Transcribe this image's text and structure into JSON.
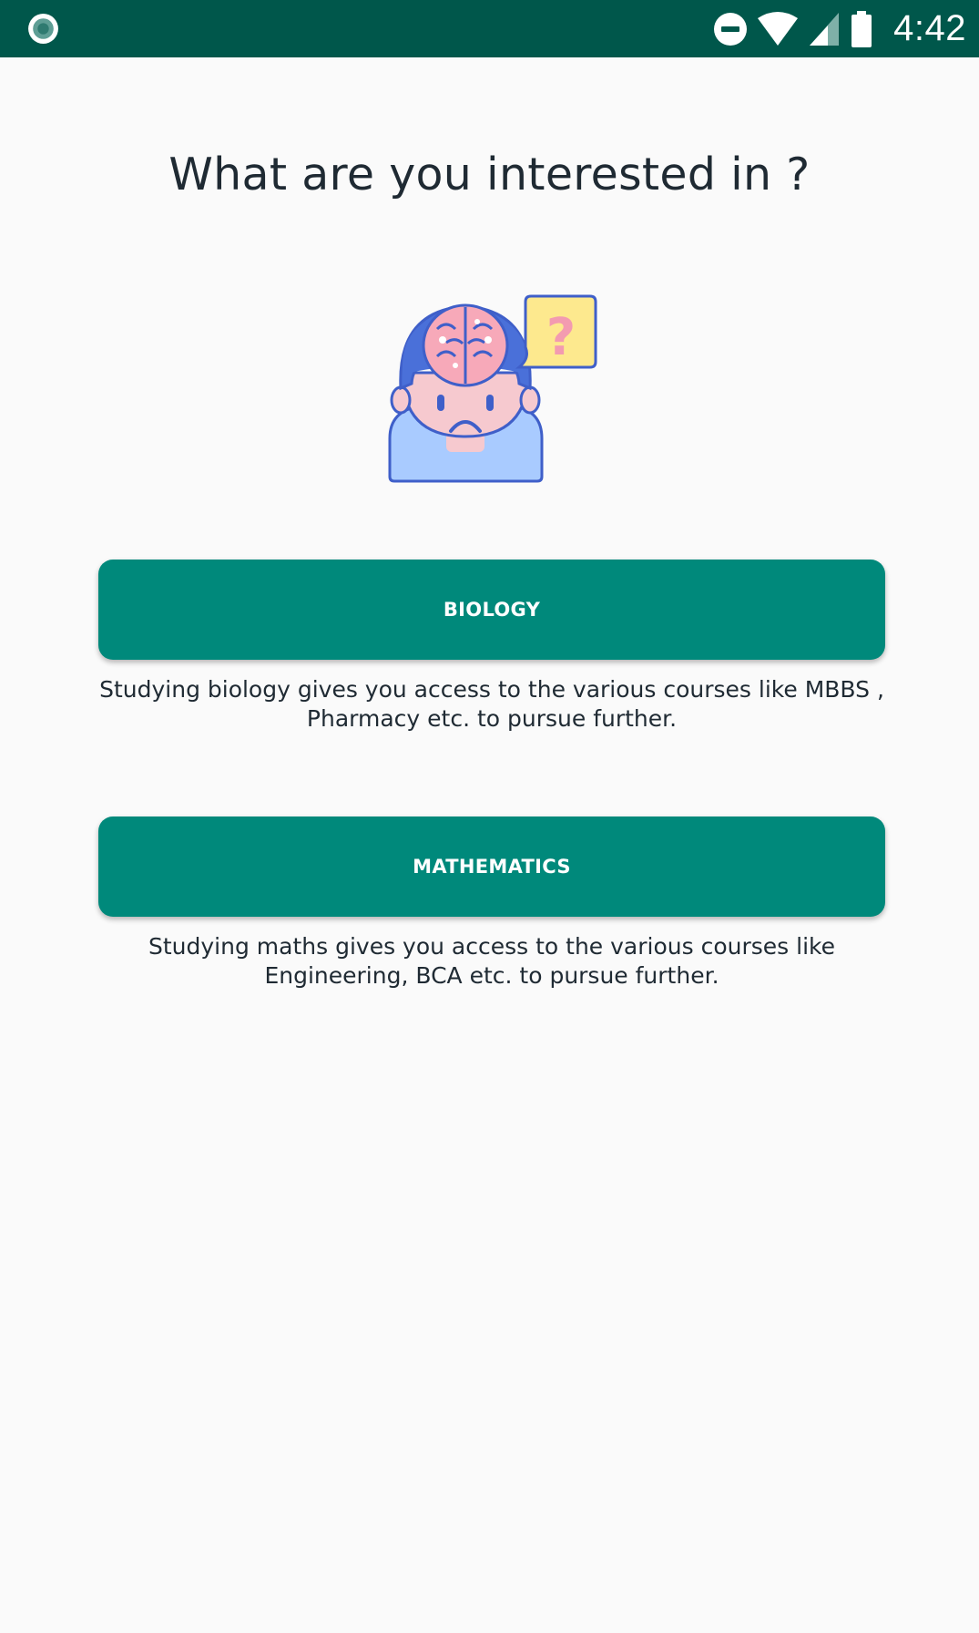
{
  "status_bar": {
    "time": "4:42",
    "background": "#00574b",
    "icons": [
      "app-notification-icon",
      "do-not-disturb-icon",
      "wifi-icon",
      "cellular-signal-icon",
      "battery-icon"
    ]
  },
  "screen": {
    "title": "What are you interested in ?",
    "illustration": "confused-person-brain-question-icon",
    "accent_color": "#00897b"
  },
  "options": [
    {
      "button_label": "BIOLOGY",
      "description": "Studying biology gives you access to the various courses like MBBS , Pharmacy etc. to pursue further."
    },
    {
      "button_label": "MATHEMATICS",
      "description": "Studying maths gives you access to the various courses like Engineering, BCA etc. to pursue further."
    }
  ]
}
